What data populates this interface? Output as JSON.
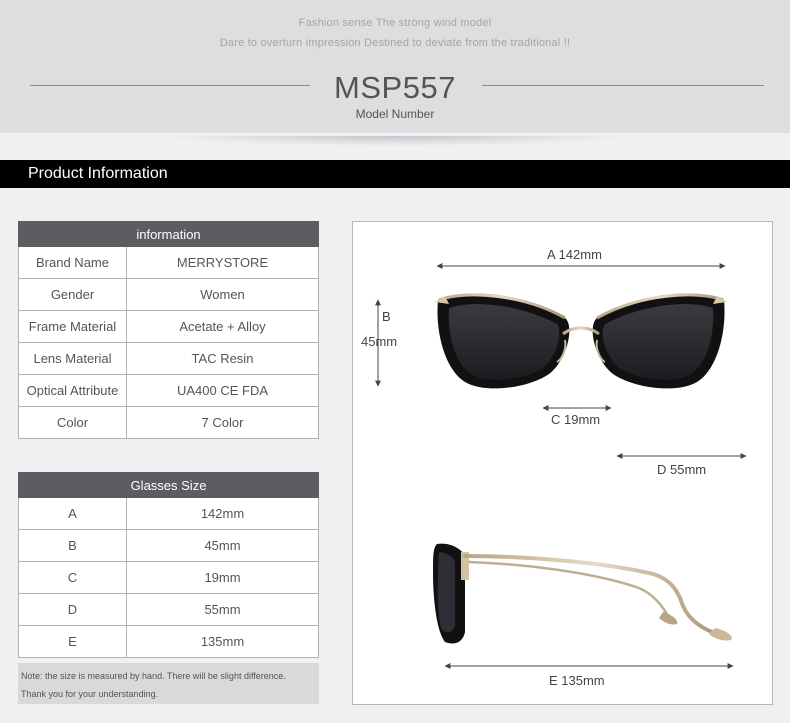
{
  "header": {
    "tagline_1": "Fashion sense The strong wind model",
    "tagline_2": "Dare to overturn impression Destined to deviate from the traditional !!",
    "model_number": "MSP557",
    "model_caption": "Model Number"
  },
  "section": {
    "title": "Product Information"
  },
  "info_table": {
    "header": "information",
    "rows": [
      {
        "key": "Brand Name",
        "value": "MERRYSTORE"
      },
      {
        "key": "Gender",
        "value": "Women"
      },
      {
        "key": "Frame Material",
        "value": "Acetate + Alloy"
      },
      {
        "key": "Lens Material",
        "value": "TAC Resin"
      },
      {
        "key": "Optical Attribute",
        "value": "UA400 CE FDA"
      },
      {
        "key": "Color",
        "value": "7 Color"
      }
    ]
  },
  "size_table": {
    "header": "Glasses Size",
    "rows": [
      {
        "key": "A",
        "value": "142mm"
      },
      {
        "key": "B",
        "value": "45mm"
      },
      {
        "key": "C",
        "value": "19mm"
      },
      {
        "key": "D",
        "value": "55mm"
      },
      {
        "key": "E",
        "value": "135mm"
      }
    ]
  },
  "note": {
    "line_1": "Note: the size is measured by hand. There will be slight difference.",
    "line_2": "Thank you for your understanding."
  },
  "dimensions": {
    "a": "A 142mm",
    "b_letter": "B",
    "b_value": "45mm",
    "c": "C 19mm",
    "d": "D 55mm",
    "e": "E 135mm"
  },
  "colors": {
    "header_bg": "#dfdde0",
    "title_bar": "#000000",
    "table_header": "#5e5c61",
    "frame_gold": "#c9b89a",
    "lens": "#2a2a2e"
  }
}
